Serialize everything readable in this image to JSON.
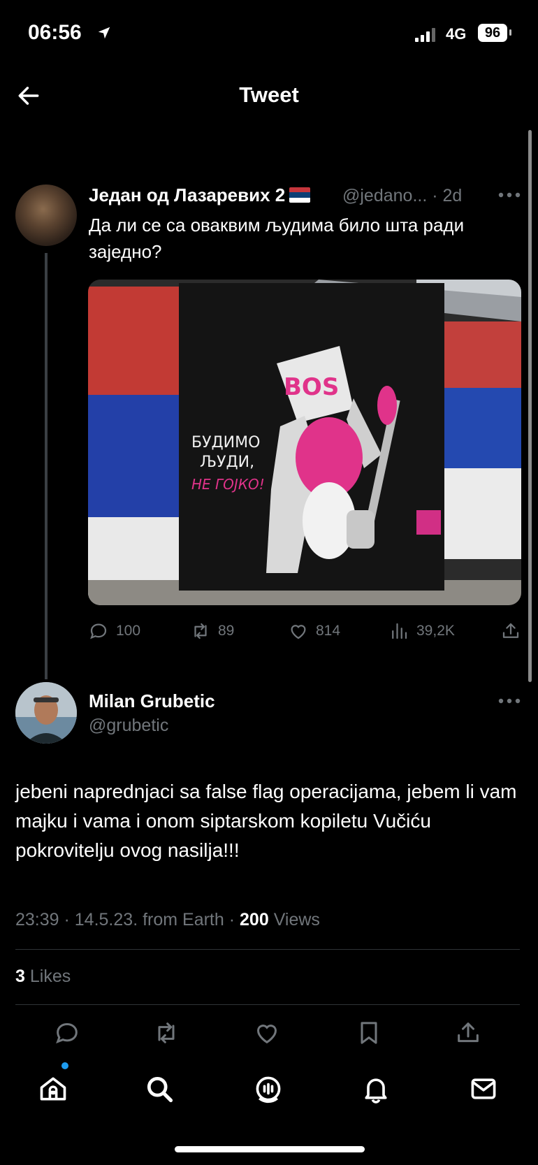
{
  "status_bar": {
    "time": "06:56",
    "network": "4G",
    "battery": "96"
  },
  "header": {
    "title": "Tweet"
  },
  "quoted_tweet": {
    "author_name": "Један од Лазаревих 2",
    "handle_time": "@jedano... · 2d",
    "text": "Да ли се са оваквим људима било шта ради заједно?",
    "media": {
      "mural_text_line1": "БУДИМО",
      "mural_text_line2": "ЉУДИ,",
      "mural_text_line3": "НЕ ГОЈКО!",
      "graffiti": "BOS"
    },
    "stats": {
      "replies": "100",
      "retweets": "89",
      "likes": "814",
      "views": "39,2K"
    }
  },
  "reply_tweet": {
    "author_name": "Milan Grubetic",
    "handle": "@grubetic",
    "text": "jebeni naprednjaci sa false flag operacijama, jebem li vam majku i vama i onom siptarskom kopiletu Vučiću pokrovitelju ovog nasilja!!!",
    "time_date": "23:39 · 14.5.23. from Earth ·",
    "views_count": "200",
    "views_label": "Views",
    "likes_count": "3",
    "likes_label": "Likes"
  },
  "colors": {
    "accent": "#1d9bf0",
    "muted": "#71767b",
    "divider": "#2f3336"
  },
  "icons": [
    "location-arrow-icon",
    "signal-icon",
    "back-arrow-icon",
    "more-icon",
    "reply-icon",
    "retweet-icon",
    "like-icon",
    "views-icon",
    "share-icon",
    "bookmark-icon",
    "home-icon",
    "search-icon",
    "spaces-icon",
    "notifications-icon",
    "messages-icon"
  ]
}
